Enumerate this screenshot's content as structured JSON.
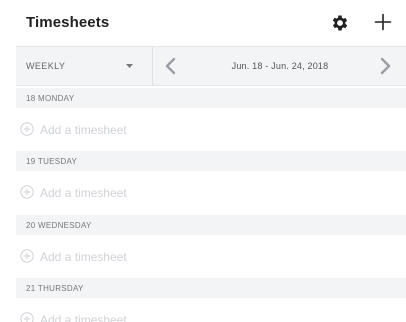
{
  "header": {
    "title": "Timesheets",
    "settings_icon": "gear-icon",
    "add_icon": "plus-icon"
  },
  "toolbar": {
    "period": "WEEKLY",
    "date_range": "Jun. 18 - Jun. 24, 2018",
    "prev_icon": "chevron-left-icon",
    "next_icon": "chevron-right-icon"
  },
  "days": [
    {
      "label": "18 MONDAY",
      "add_label": "Add a timesheet"
    },
    {
      "label": "19 TUESDAY",
      "add_label": "Add a timesheet"
    },
    {
      "label": "20 WEDNESDAY",
      "add_label": "Add a timesheet"
    },
    {
      "label": "21 THURSDAY",
      "add_label": "Add a timesheet"
    }
  ],
  "colors": {
    "header_bg": "#ffffff",
    "band_bg": "#f3f4f5",
    "muted_text": "#cfd2d6",
    "icon_dark": "#222222"
  }
}
